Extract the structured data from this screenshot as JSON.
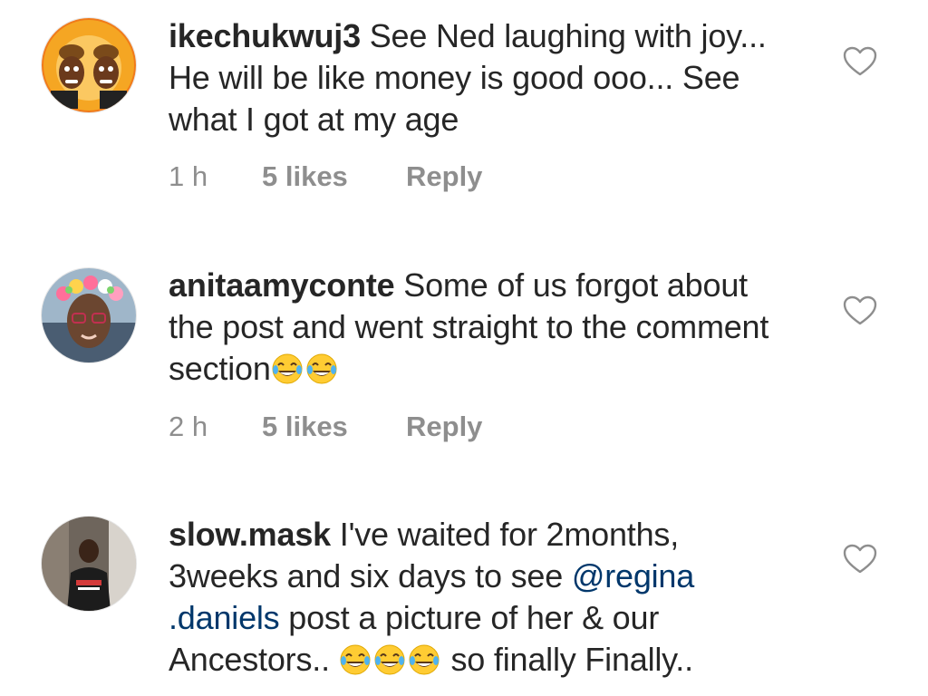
{
  "comments": [
    {
      "username": "ikechukwuj3",
      "text_parts": [
        {
          "type": "text",
          "value": " See Ned laughing with joy... He will be like money is good ooo... See what I got at my age"
        }
      ],
      "time": "1 h",
      "likes": "5 likes",
      "reply": "Reply",
      "avatar_icon": "cartoon-duo-avatar",
      "like_icon": "heart-outline-icon"
    },
    {
      "username": "anitaamyconte",
      "text_parts": [
        {
          "type": "text",
          "value": " Some of us forgot about the post and went straight to the comment section"
        },
        {
          "type": "emoji",
          "value": "😂"
        },
        {
          "type": "emoji",
          "value": "😂"
        }
      ],
      "time": "2 h",
      "likes": "5 likes",
      "reply": "Reply",
      "avatar_icon": "flower-crown-selfie-avatar",
      "like_icon": "heart-outline-icon"
    },
    {
      "username": "slow.mask",
      "text_parts": [
        {
          "type": "text",
          "value": " I've waited for 2months, 3weeks and six days to see "
        },
        {
          "type": "mention",
          "value": "@regina .daniels"
        },
        {
          "type": "text",
          "value": " post a picture of her & our Ancestors.. "
        },
        {
          "type": "emoji",
          "value": "😂"
        },
        {
          "type": "emoji",
          "value": "😂"
        },
        {
          "type": "emoji",
          "value": "😂"
        },
        {
          "type": "text",
          "value": " so finally Finally.."
        }
      ],
      "avatar_icon": "person-in-doorway-avatar",
      "like_icon": "heart-outline-icon"
    }
  ],
  "colors": {
    "text": "#262626",
    "meta": "#8e8e8e",
    "mention": "#00376b",
    "emoji_face": "#ffcc33"
  }
}
